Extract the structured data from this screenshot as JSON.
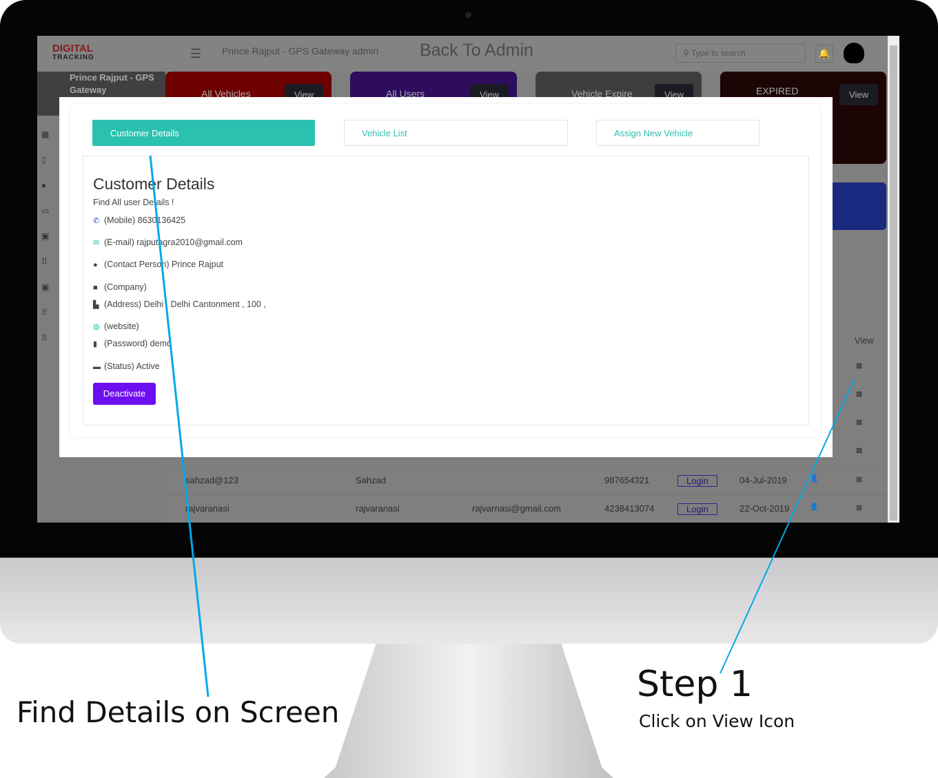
{
  "header": {
    "logo_top": "DIGITAL",
    "logo_bottom": "TRACKING",
    "title": "Prince Rajput - GPS Gateway admin",
    "back": "Back To Admin",
    "search_placeholder": "Type to search"
  },
  "sidebar": {
    "profile": "Prince Rajput - GPS Gateway"
  },
  "cards": [
    {
      "label": "All Vehicles",
      "view": "View",
      "color": "#6e0000"
    },
    {
      "label": "All Users",
      "view": "View",
      "color": "#2e0c5e"
    },
    {
      "label": "Vehicle Expire",
      "view": "View",
      "color": "#3d3d3d"
    },
    {
      "label": "EXPIRED",
      "view": "View",
      "color": "#1c0505"
    }
  ],
  "table": {
    "view_header": "View",
    "rows": [
      {
        "username": "sahzad@123",
        "name": "Sahzad",
        "email": "",
        "mobile": "987654321",
        "login": "Login",
        "date": "04-Jul-2019"
      },
      {
        "username": "rajvaranasi",
        "name": "rajvaranasi",
        "email": "rajvarnasi@gmail.com",
        "mobile": "4238413074",
        "login": "Login",
        "date": "22-Oct-2019"
      }
    ]
  },
  "modal": {
    "tabs": [
      "Customer Details",
      "Vehicle List",
      "Assign New Vehicle"
    ],
    "title": "Customer Details",
    "subtitle": "Find All user Details !",
    "fields": [
      {
        "icon": "phone-icon",
        "glyph": "📞",
        "text": "(Mobile) 8630136425"
      },
      {
        "icon": "mail-icon",
        "glyph": "✉",
        "text": "(E-mail) rajputagra2010@gmail.com"
      },
      {
        "icon": "user-icon",
        "glyph": "●",
        "text": "(Contact Person) Prince Rajput"
      },
      {
        "icon": "briefcase-icon",
        "glyph": "■",
        "text": "(Company)"
      },
      {
        "icon": "building-icon",
        "glyph": "▙",
        "text": "(Address) Delhi , Delhi Cantonment , 100 ,"
      },
      {
        "icon": "globe-icon",
        "glyph": "◍",
        "text": "(website)"
      },
      {
        "icon": "key-icon",
        "glyph": "▮",
        "text": "(Password) demo"
      },
      {
        "icon": "status-icon",
        "glyph": "▬",
        "text": "(Status) Active"
      }
    ],
    "deactivate": "Deactivate",
    "accent": "#2bc1b1",
    "button_color": "#6c0ef0"
  },
  "annotations": {
    "find": "Find Details on Screen",
    "step": "Step 1",
    "step_sub": "Click on View Icon",
    "line_color": "#00a8e8"
  }
}
